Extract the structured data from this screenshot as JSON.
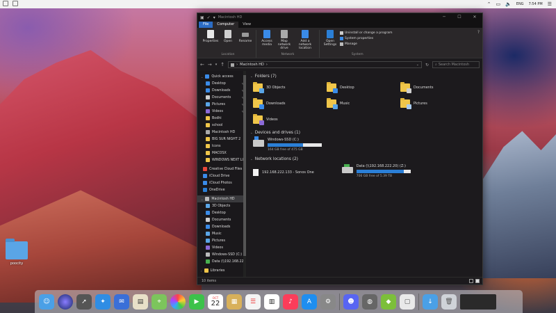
{
  "menubar": {
    "language": "ENG",
    "time": "7:54 PM"
  },
  "window": {
    "title": "Macintosh HD",
    "tabs": {
      "file": "File",
      "computer": "Computer",
      "view": "View"
    },
    "ribbon": {
      "location": {
        "label": "Location",
        "buttons": [
          {
            "label": "Properties"
          },
          {
            "label": "Open"
          },
          {
            "label": "Rename"
          }
        ]
      },
      "network": {
        "label": "Network",
        "buttons": [
          {
            "label": "Access media"
          },
          {
            "label": "Map network drive"
          },
          {
            "label": "Add a network location"
          }
        ]
      },
      "system": {
        "label": "System",
        "open_settings": "Open Settings",
        "items": [
          {
            "label": "Uninstall or change a program"
          },
          {
            "label": "System properties"
          },
          {
            "label": "Manage"
          }
        ]
      }
    },
    "address": {
      "path": "Macintosh HD",
      "search_placeholder": "Search Macintosh"
    },
    "nav": {
      "quick_access": "Quick access",
      "quick_items": [
        "Desktop",
        "Downloads",
        "Documents",
        "Pictures",
        "Videos",
        "Bodhi",
        "school",
        "Macintosh HD",
        "BIG SUR NIGHT 2",
        "Icons",
        "MACOSX",
        "WINDOWS NEXT LIG"
      ],
      "top_items": [
        "Creative Cloud Files",
        "iCloud Drive",
        "iCloud Photos",
        "OneDrive"
      ],
      "this_pc": "Macintosh HD",
      "pc_items": [
        "3D Objects",
        "Desktop",
        "Documents",
        "Downloads",
        "Music",
        "Pictures",
        "Videos",
        "Windows-SSD (C:)",
        "Data (\\\\192.168.222.2"
      ],
      "libraries": "Libraries"
    },
    "folders": {
      "header": "Folders (7)",
      "items": [
        "3D Objects",
        "Desktop",
        "Documents",
        "Downloads",
        "Music",
        "Pictures",
        "Videos"
      ]
    },
    "devices": {
      "header": "Devices and drives (1)",
      "items": [
        {
          "name": "Windows-SSD (C:)",
          "free": "164 GB free of 475 GB",
          "used_fraction": 0.65
        }
      ]
    },
    "network_locations": {
      "header": "Network locations (2)",
      "items": [
        {
          "name": "192.168.222.133 - Sonos One"
        },
        {
          "name": "Data (\\\\192.168.222.20) (Z:)",
          "free": "706 GB free of 5.39 TB",
          "used_fraction": 0.87
        }
      ]
    },
    "status": {
      "count": "10 items"
    }
  },
  "desktop_icon": {
    "label": "poocity"
  },
  "dock": {
    "calendar_month": "OCT",
    "calendar_day": "22"
  },
  "colors": {
    "accent": "#2b6cc4",
    "folder": "#f0c64a",
    "bar_fill": "#2b7fd6"
  }
}
